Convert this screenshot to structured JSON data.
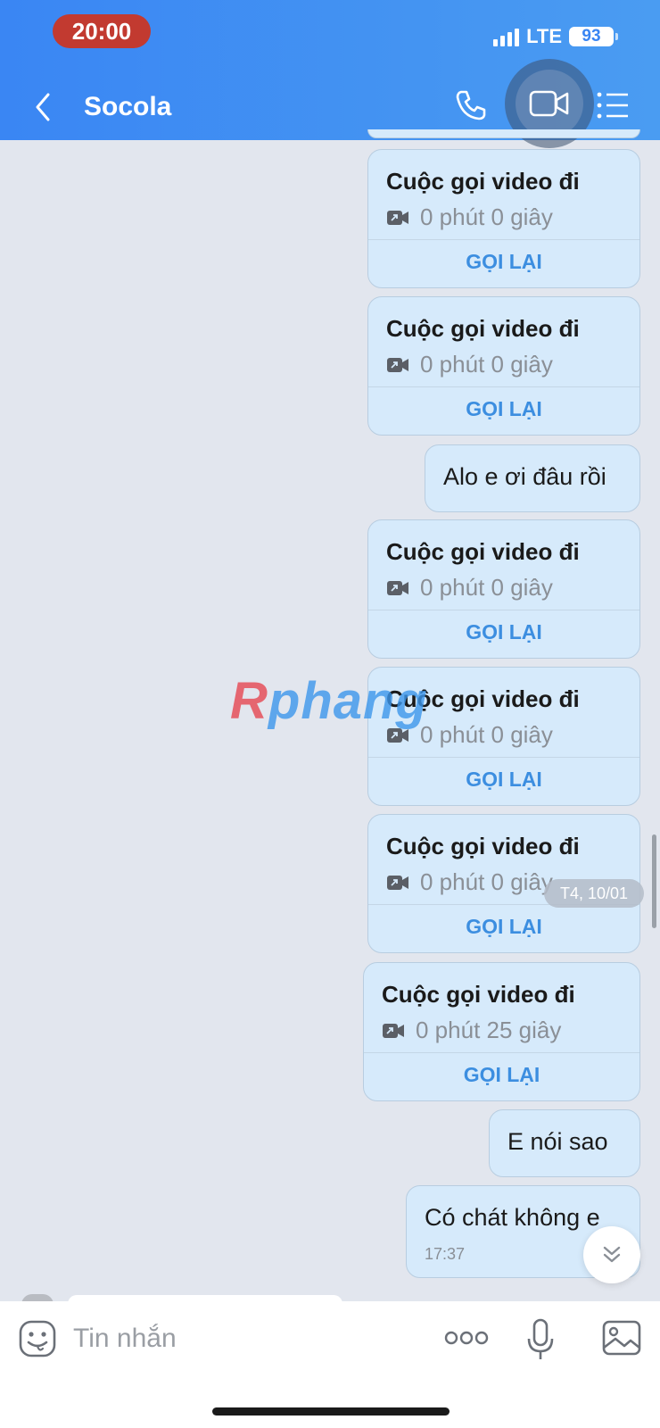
{
  "status_bar": {
    "time": "20:00",
    "network": "LTE",
    "battery": "93"
  },
  "header": {
    "title": "Socola",
    "icons": [
      "back-icon",
      "phone-icon",
      "video-call-icon",
      "menu-icon"
    ]
  },
  "messages": [
    {
      "type": "call",
      "title": "Cuộc gọi video đi",
      "duration": "0 phút 0 giây",
      "action": "GỌI LẠI"
    },
    {
      "type": "call",
      "title": "Cuộc gọi video đi",
      "duration": "0 phút 0 giây",
      "action": "GỌI LẠI"
    },
    {
      "type": "text",
      "text": "Alo e ơi đâu rồi"
    },
    {
      "type": "call",
      "title": "Cuộc gọi video đi",
      "duration": "0 phút 0 giây",
      "action": "GỌI LẠI"
    },
    {
      "type": "call",
      "title": "Cuộc gọi video đi",
      "duration": "0 phút 0 giây",
      "action": "GỌI LẠI"
    },
    {
      "type": "call",
      "title": "Cuộc gọi video đi",
      "duration": "0 phút 0 giây",
      "action": "GỌI LẠI"
    },
    {
      "type": "call",
      "title": "Cuộc gọi video đi",
      "duration": "0 phút 25 giây",
      "action": "GỌI LẠI"
    },
    {
      "type": "text",
      "text": "E nói sao"
    },
    {
      "type": "text",
      "text": "Có chát không e",
      "time": "17:37"
    }
  ],
  "date_label": "T4, 10/01",
  "watermark": {
    "part1": "R",
    "part2": "phang"
  },
  "input": {
    "placeholder": "Tin nhắn"
  },
  "colors": {
    "header": "#3a86f3",
    "bubble": "#d6eafb",
    "callback": "#3c8ee0",
    "background": "#e2e6ee"
  }
}
